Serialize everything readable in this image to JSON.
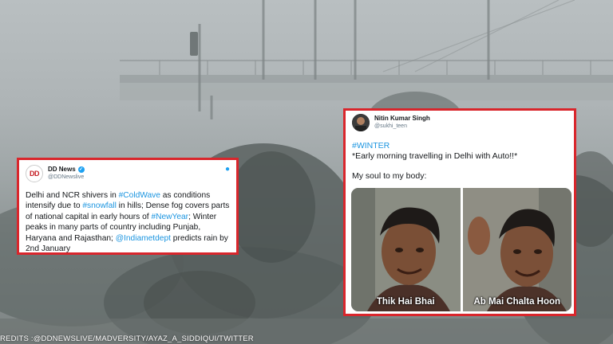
{
  "colors": {
    "border": "#d9262c",
    "link": "#1b95e0",
    "verified": "#1da1f2"
  },
  "dd_tweet": {
    "avatar_text": "DD",
    "display_name": "DD News",
    "handle": "@DDNewslive",
    "parts": [
      {
        "text": "Delhi and NCR shivers in ",
        "link": false
      },
      {
        "text": "#ColdWave",
        "link": true
      },
      {
        "text": " as conditions intensify due to ",
        "link": false
      },
      {
        "text": "#snowfall",
        "link": true
      },
      {
        "text": " in hills; Dense fog covers parts of national capital in early hours of ",
        "link": false
      },
      {
        "text": "#NewYear",
        "link": true
      },
      {
        "text": "; Winter peaks in many parts of country including Punjab, Haryana and Rajasthan; ",
        "link": false
      },
      {
        "text": "@Indiametdept",
        "link": true
      },
      {
        "text": " predicts rain by 2nd January",
        "link": false
      }
    ]
  },
  "nitin_tweet": {
    "display_name": "Nitin Kumar Singh",
    "handle": "@sukhi_teen",
    "hashtag": "#WINTER",
    "line1": "*Early morning travelling in Delhi with Auto!!*",
    "line2": "My soul to my body:",
    "memes": [
      {
        "caption": "Thik Hai Bhai"
      },
      {
        "caption": "Ab Mai Chalta Hoon"
      }
    ]
  },
  "credits": "REDITS :@DDNEWSLIVE/MADVERSITY/AYAZ_A_SIDDIQUI/TWITTER"
}
